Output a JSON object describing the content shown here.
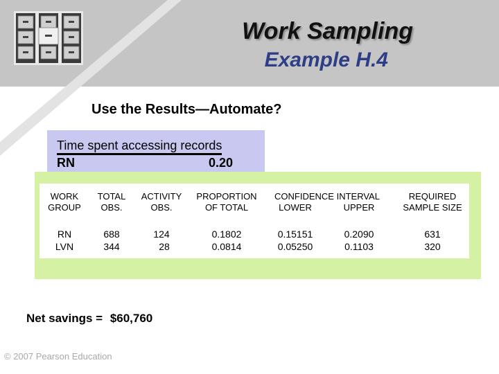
{
  "header": {
    "title": "Work Sampling",
    "subtitle": "Example H.4",
    "logo_icon": "file-cabinet-icon"
  },
  "slide": {
    "heading": "Use the Results—Automate?",
    "highlight": {
      "label": "Time spent accessing records",
      "row_label": "RN",
      "row_value": "0.20"
    },
    "table": {
      "headers": {
        "work_group": [
          "WORK",
          "GROUP"
        ],
        "total_obs": [
          "TOTAL",
          "OBS."
        ],
        "activity_obs": [
          "ACTIVITY",
          "OBS."
        ],
        "proportion": [
          "PROPORTION",
          "OF TOTAL"
        ],
        "confidence": "CONFIDENCE INTERVAL",
        "lower": "LOWER",
        "upper": "UPPER",
        "required": [
          "REQUIRED",
          "SAMPLE SIZE"
        ]
      },
      "rows": [
        {
          "group": "RN",
          "total": "688",
          "activity": "124",
          "proportion": "0.1802",
          "lower": "0.15151",
          "upper": "0.2090",
          "required": "631"
        },
        {
          "group": "LVN",
          "total": "344",
          "activity": "28",
          "proportion": "0.0814",
          "lower": "0.05250",
          "upper": "0.1103",
          "required": "320"
        }
      ]
    },
    "net_savings_label": "Net savings =",
    "net_savings_value": "$60,760",
    "copyright": "© 2007 Pearson Education"
  },
  "colors": {
    "band": "#c5c5c5",
    "subtitle": "#2e3e86",
    "highlight_box": "#c8c8f0",
    "table_box": "#d5f2a4",
    "footer": "#a9a9a9"
  }
}
